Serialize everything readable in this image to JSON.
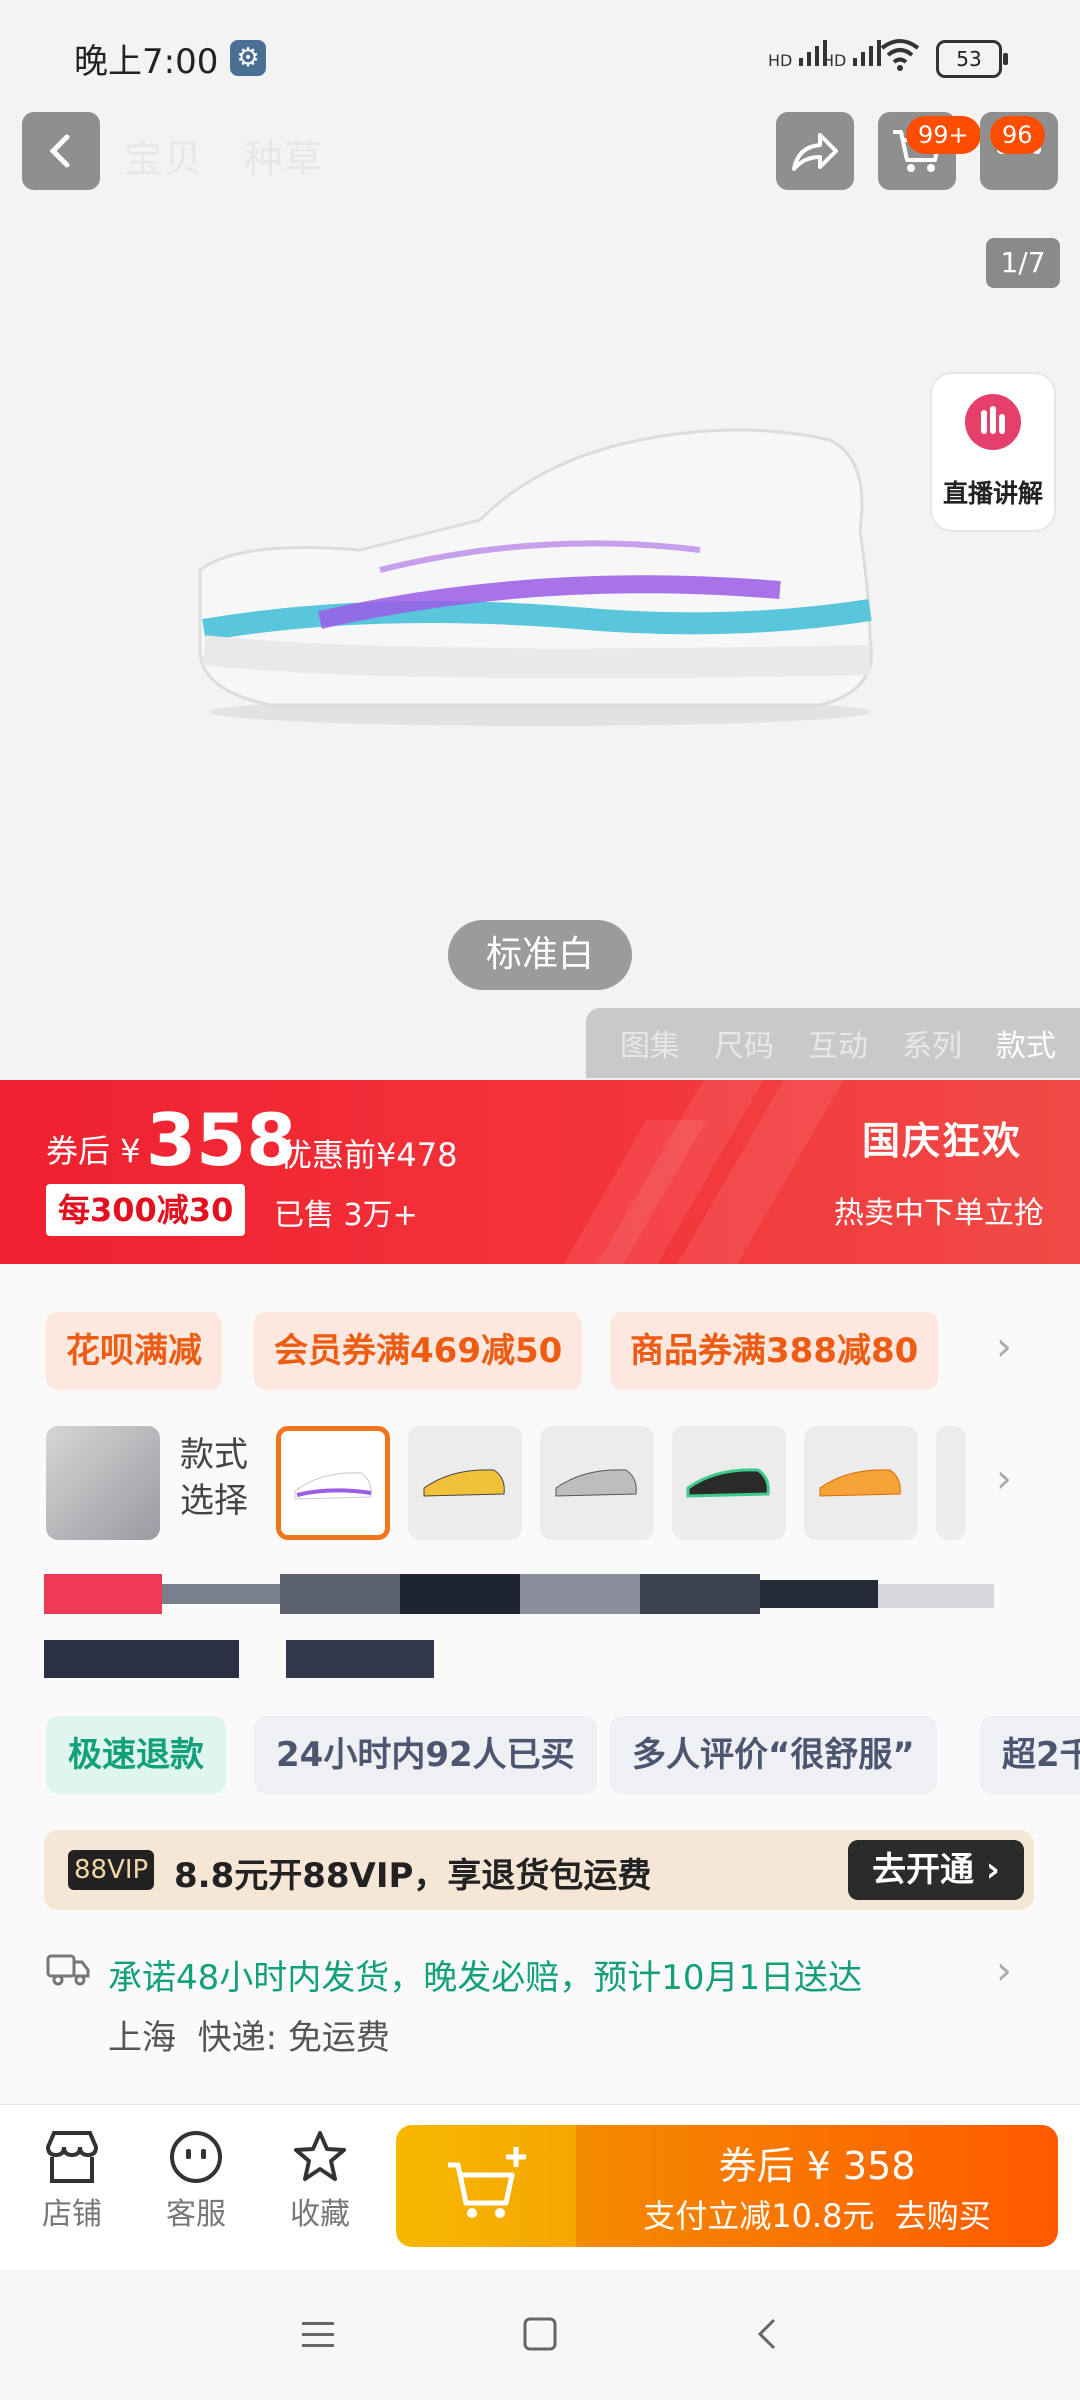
{
  "status_bar": {
    "time": "晚上7:00",
    "signal1": "HD",
    "signal2": "HD",
    "battery": "53"
  },
  "nav": {
    "tabs": [
      "宝贝",
      "种草"
    ],
    "cart_badge": "99+",
    "msg_badge": "96",
    "page_counter": "1/7"
  },
  "live": {
    "label": "直播讲解"
  },
  "product_image": {
    "color_label": "标准白"
  },
  "gallery_tabs": [
    "图集",
    "尺码",
    "互动",
    "系列",
    "款式"
  ],
  "price_banner": {
    "after_label": "券后 ¥",
    "price": "358",
    "before_price": "优惠前¥478",
    "discount": "每300减30",
    "sold": "已售 3万+",
    "festival": "国庆狂欢",
    "hot": "热卖中下单立抢"
  },
  "coupons": [
    "花呗满减",
    "会员券满469减50",
    "商品券满388减80"
  ],
  "style_select": {
    "label_line1": "款式",
    "label_line2": "选择"
  },
  "tags": [
    "极速退款",
    "24小时内92人已买",
    "多人评价“很舒服”",
    "超2千"
  ],
  "vip": {
    "logo": "88VIP",
    "text": "8.8元开88VIP，享退货包运费",
    "button": "去开通"
  },
  "shipping": {
    "promise": "承诺48小时内发货，晚发必赔，预计10月1日送达",
    "detail": "上海  快递: 免运费"
  },
  "bottom_bar": {
    "shop": "店铺",
    "service": "客服",
    "favorite": "收藏",
    "buy_line1": "券后 ¥ 358",
    "buy_line2": "支付立减10.8元  去购买"
  },
  "colors": {
    "accent_red": "#f0202f",
    "accent_orange": "#ff5a00",
    "brand_green": "#12a07a"
  }
}
